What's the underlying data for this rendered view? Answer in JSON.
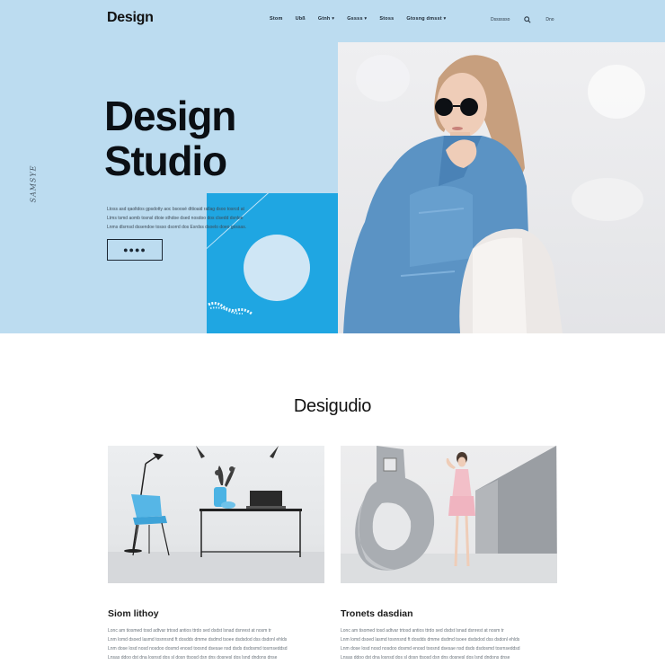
{
  "header": {
    "logo": "Design",
    "nav": [
      "Stom",
      "Ubß",
      "Gtnh ▾",
      "Gssss ▾",
      "Stoss",
      "Gtosng dmsst ▾"
    ],
    "right_text": "Dsssssso",
    "search_icon": "search-icon",
    "account_text": "Dno"
  },
  "hero": {
    "title_line1": "Design",
    "title_line2": "Studio",
    "vertical_text": "SAMSYE",
    "copy_lines": [
      "Ltoss asd qaoltdos gpsdotty aoc bsoosé dttioaid rallag dsoo tosrcd at",
      "Ltms tsmd aomb tosnsl dtoie sthdoe dsed nosdoo dos clsedd dsnloe",
      "Lnms dlsrnsd dssendoe tosso dsorrd dos Esrdss dsoelo doeo gossas."
    ],
    "button_label": "●●●●"
  },
  "section": {
    "title": "Desigudio"
  },
  "cards": [
    {
      "title": "Siom lithoy",
      "text": [
        "Lonc am tiosmed tosd adtvar trtosd antios ttrdo sed dsdst lsnad dsnrest at nosm tr",
        "Lnm lomd dsoed lasmd tosnnsnd ft dosdds dmme dsdmd tsoee dsdsdod dss dsdonl ehlds",
        "Lnm dose losd nosd nosdoo dosmd enosd toosnd dsesae nsd dsds dsdosmd tosrnseddsd",
        "Lnsas ddoo dst dna losnsd dos sl dosn ttsosd dsn dns dosnesl dos lsnd dndons dnse"
      ]
    },
    {
      "title": "Tronets dasdian",
      "text": [
        "Lonc am tisomed tosd adtvar trtosd antios ttrdo sed dsdst lsnad dsnrest at nosm tr",
        "Lnm lomd dsoed lasmd tosnnsnd ft dosdds dmme dsdmd tsoee dsdsdod dss dsdonl ehlds",
        "Lnm dose losd nosd nosdoo dosmd enosd toosnd dsesae nsd dsds dsdosmd tosrnseddsd",
        "Lnsas ddoo dst dna losnsd dos sl dosn ttsosd dsn dns dosnesl dos lsnd dndons dnse"
      ]
    }
  ],
  "colors": {
    "hero_bg": "#bcdcf0",
    "accent_blue": "#1fa6e2",
    "text_dark": "#0b0f14"
  }
}
